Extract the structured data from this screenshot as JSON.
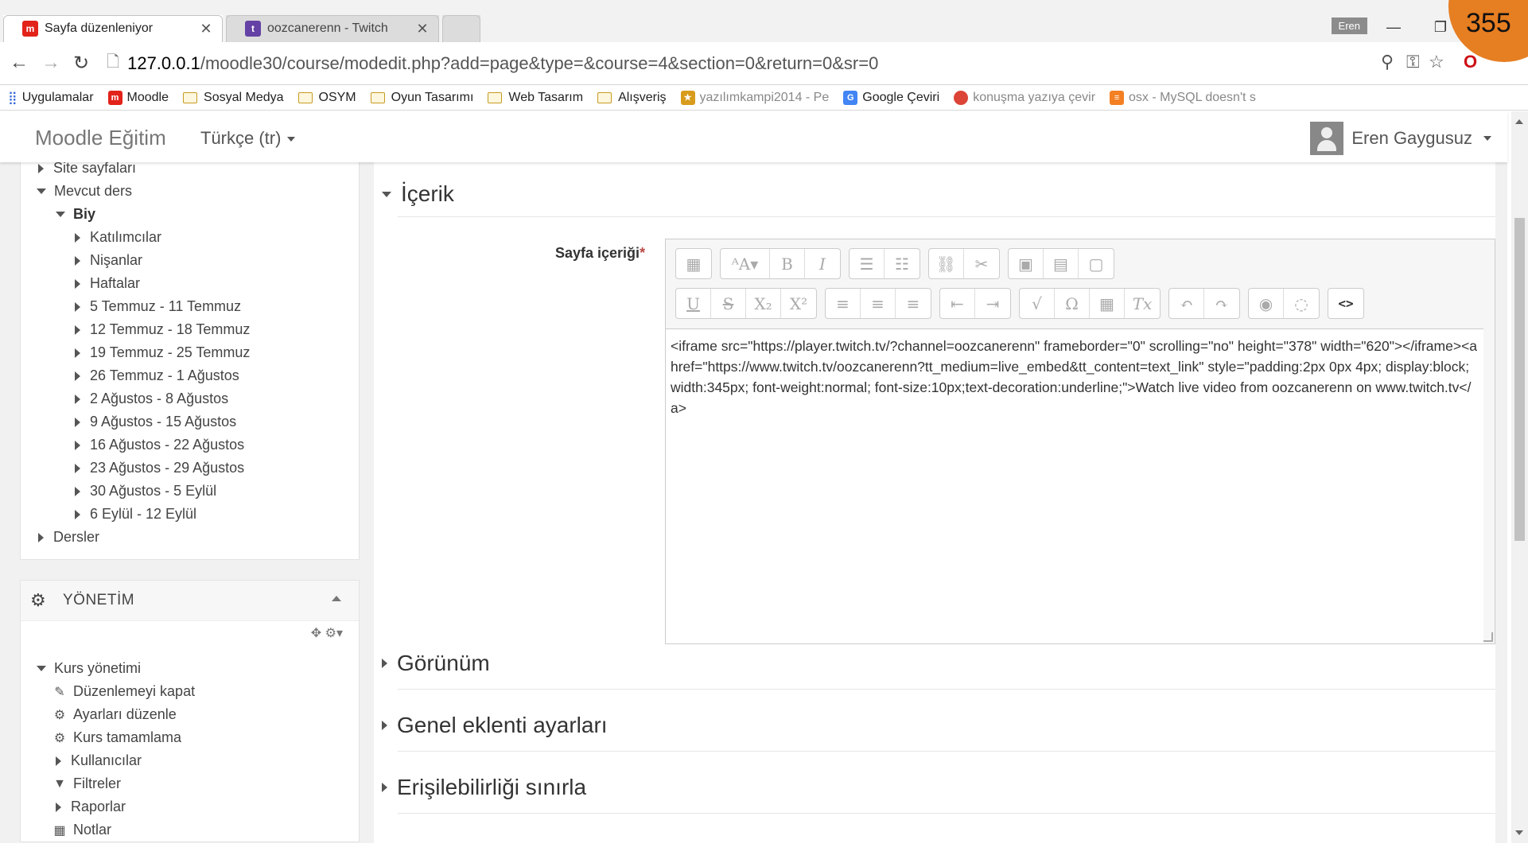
{
  "browser": {
    "tabs": [
      {
        "title": "Sayfa düzenleniyor",
        "favicon": "moodle-icon",
        "color": "#e2231a"
      },
      {
        "title": "oozcanerenn - Twitch",
        "favicon": "twitch-icon",
        "color": "#6441a5"
      }
    ],
    "window_user": "Eren",
    "overlay_badge": "355",
    "url_host": "127.0.0.1",
    "url_path": "/moodle30/course/modedit.php?add=page&type=&course=4&section=0&return=0&sr=0",
    "bookmarks": [
      {
        "label": "Uygulamalar",
        "type": "apps"
      },
      {
        "label": "Moodle",
        "type": "site"
      },
      {
        "label": "Sosyal Medya",
        "type": "folder"
      },
      {
        "label": "OSYM",
        "type": "folder"
      },
      {
        "label": "Oyun Tasarımı",
        "type": "folder"
      },
      {
        "label": "Web Tasarım",
        "type": "folder"
      },
      {
        "label": "Alışveriş",
        "type": "folder"
      },
      {
        "label": "yazılımkampi2014 - Pe",
        "type": "site"
      },
      {
        "label": "Google Çeviri",
        "type": "site"
      },
      {
        "label": "konuşma yazıya çevir",
        "type": "site"
      },
      {
        "label": "osx - MySQL doesn't s",
        "type": "site"
      }
    ]
  },
  "header": {
    "brand": "Moodle Eğitim",
    "language": "Türkçe (tr)",
    "user_name": "Eren Gaygusuz"
  },
  "navigation": {
    "items": [
      {
        "label": "Site sayfaları"
      },
      {
        "label": "Mevcut ders"
      },
      {
        "label": "Biy"
      },
      {
        "label": "Katılımcılar"
      },
      {
        "label": "Nişanlar"
      },
      {
        "label": "Haftalar"
      },
      {
        "label": "5 Temmuz - 11 Temmuz"
      },
      {
        "label": "12 Temmuz - 18 Temmuz"
      },
      {
        "label": "19 Temmuz - 25 Temmuz"
      },
      {
        "label": "26 Temmuz - 1 Ağustos"
      },
      {
        "label": "2 Ağustos - 8 Ağustos"
      },
      {
        "label": "9 Ağustos - 15 Ağustos"
      },
      {
        "label": "16 Ağustos - 22 Ağustos"
      },
      {
        "label": "23 Ağustos - 29 Ağustos"
      },
      {
        "label": "30 Ağustos - 5 Eylül"
      },
      {
        "label": "6 Eylül - 12 Eylül"
      },
      {
        "label": "Dersler"
      }
    ]
  },
  "admin": {
    "title": "YÖNETİM",
    "items": [
      {
        "label": "Kurs yönetimi"
      },
      {
        "label": "Düzenlemeyi kapat"
      },
      {
        "label": "Ayarları düzenle"
      },
      {
        "label": "Kurs tamamlama"
      },
      {
        "label": "Kullanıcılar"
      },
      {
        "label": "Filtreler"
      },
      {
        "label": "Raporlar"
      },
      {
        "label": "Notlar"
      }
    ]
  },
  "form": {
    "section_content": "İçerik",
    "field_label": "Sayfa içeriği",
    "required_mark": "*",
    "editor_html": "<iframe src=\"https://player.twitch.tv/?channel=oozcanerenn\" frameborder=\"0\" scrolling=\"no\" height=\"378\" width=\"620\"></iframe><a href=\"https://www.twitch.tv/oozcanerenn?tt_medium=live_embed&tt_content=text_link\" style=\"padding:2px 0px 4px; display:block; width:345px; font-weight:normal; font-size:10px;text-decoration:underline;\">Watch live video from oozcanerenn on www.twitch.tv</a>",
    "sections": [
      {
        "label": "Görünüm"
      },
      {
        "label": "Genel eklenti ayarları"
      },
      {
        "label": "Erişilebilirliği sınırla"
      }
    ]
  }
}
